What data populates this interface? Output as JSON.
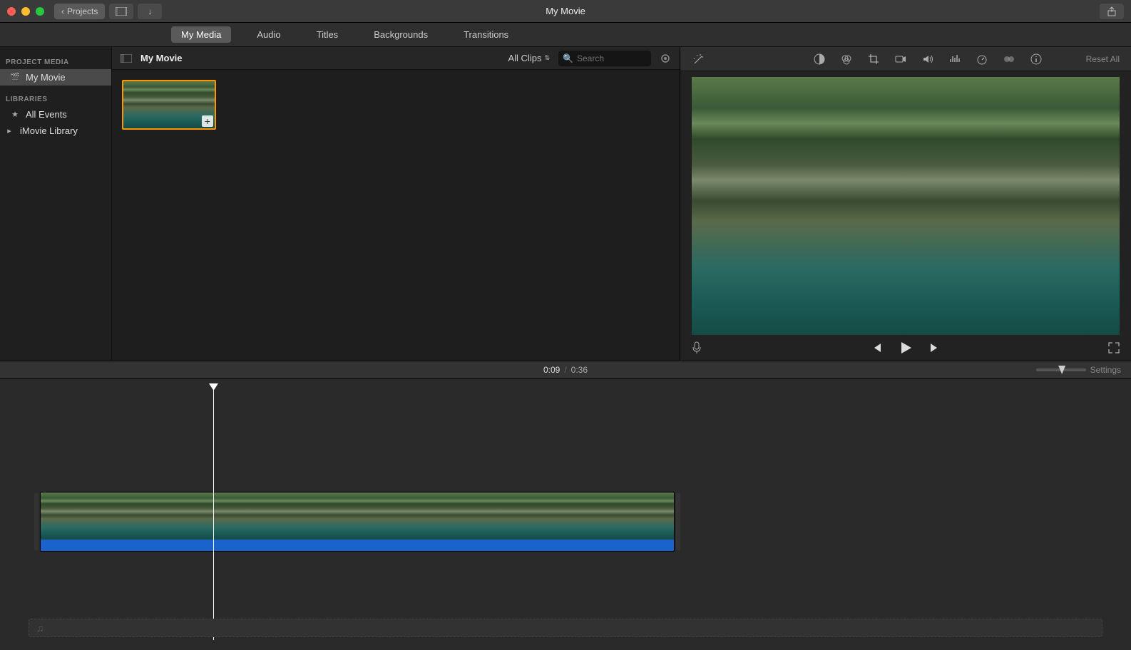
{
  "titlebar": {
    "back_label": "Projects",
    "title": "My Movie"
  },
  "tabs": [
    {
      "label": "My Media",
      "active": true
    },
    {
      "label": "Audio",
      "active": false
    },
    {
      "label": "Titles",
      "active": false
    },
    {
      "label": "Backgrounds",
      "active": false
    },
    {
      "label": "Transitions",
      "active": false
    }
  ],
  "sidebar": {
    "section_project": "PROJECT MEDIA",
    "project_item": "My Movie",
    "section_libraries": "LIBRARIES",
    "libraries": [
      {
        "label": "All Events",
        "icon": "star"
      },
      {
        "label": "iMovie Library",
        "icon": "disclosure"
      }
    ]
  },
  "browser": {
    "title": "My Movie",
    "filter_label": "All Clips",
    "search_placeholder": "Search"
  },
  "viewer": {
    "reset_label": "Reset All"
  },
  "timebar": {
    "current": "0:09",
    "separator": "/",
    "total": "0:36",
    "settings_label": "Settings"
  },
  "colors": {
    "close": "#ff5f57",
    "minimize": "#febc2e",
    "zoom": "#28c840",
    "selection": "#ff9500",
    "audio": "#1a62cc"
  }
}
